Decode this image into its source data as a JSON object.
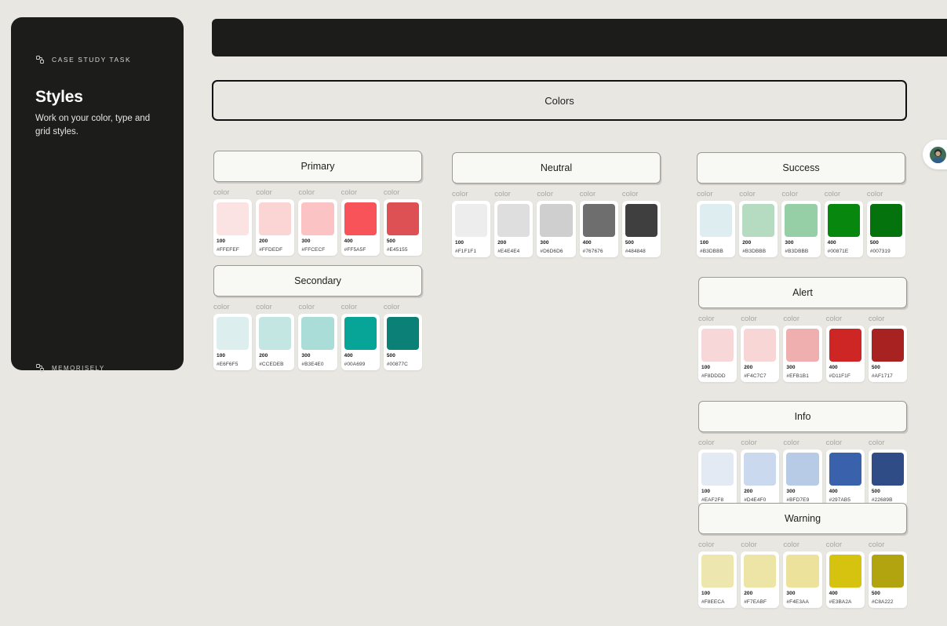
{
  "sidebar": {
    "tag_label": "Case study task",
    "tag_icon": "memorisely-logo-icon",
    "title": "Styles",
    "description": "Work on your color, type and grid styles.",
    "footer_label": "Memorisely",
    "footer_icon": "memorisely-logo-icon",
    "background_color": "#1C1C1B"
  },
  "topbar": {
    "background_color": "#1C1C1B"
  },
  "avatars": {
    "count": 2,
    "items": [
      {
        "name": "collaborator-avatar-1"
      },
      {
        "name": "collaborator-avatar-2"
      }
    ]
  },
  "canvas": {
    "background_color": "#E8E7E2",
    "selected_frame": {
      "title": "Colors",
      "border_color": "#111111"
    }
  },
  "color_groups": [
    {
      "name": "Primary",
      "swatch_caption": "color",
      "swatches": [
        {
          "step": "100",
          "hex": "#FFEFEF",
          "fill": "#FCE3E3"
        },
        {
          "step": "200",
          "hex": "#FFDEDF",
          "fill": "#FBD4D4"
        },
        {
          "step": "300",
          "hex": "#FFCECF",
          "fill": "#FBC3C3"
        },
        {
          "step": "400",
          "hex": "#FF5A5F",
          "fill": "#F75358"
        },
        {
          "step": "500",
          "hex": "#E45155",
          "fill": "#DD5054"
        }
      ]
    },
    {
      "name": "Secondary",
      "swatch_caption": "color",
      "swatches": [
        {
          "step": "100",
          "hex": "#E6F6F5",
          "fill": "#DCEFEE"
        },
        {
          "step": "200",
          "hex": "#CCEDEB",
          "fill": "#C4E6E3"
        },
        {
          "step": "300",
          "hex": "#B3E4E0",
          "fill": "#ABDDD8"
        },
        {
          "step": "400",
          "hex": "#00A699",
          "fill": "#07A598"
        },
        {
          "step": "500",
          "hex": "#00877C",
          "fill": "#0A8076"
        }
      ]
    },
    {
      "name": "Neutral",
      "swatch_caption": "color",
      "swatches": [
        {
          "step": "100",
          "hex": "#F1F1F1",
          "fill": "#EDEDED"
        },
        {
          "step": "200",
          "hex": "#E4E4E4",
          "fill": "#DEDEDE"
        },
        {
          "step": "300",
          "hex": "#D6D6D6",
          "fill": "#CFCFCF"
        },
        {
          "step": "400",
          "hex": "#767676",
          "fill": "#6E6E6E"
        },
        {
          "step": "500",
          "hex": "#484848",
          "fill": "#3F3F3F"
        }
      ]
    },
    {
      "name": "Success",
      "swatch_caption": "color",
      "swatches": [
        {
          "step": "100",
          "hex": "#B3DBBB",
          "fill": "#DEEEF0"
        },
        {
          "step": "200",
          "hex": "#B3DBBB",
          "fill": "#B5DCC0"
        },
        {
          "step": "300",
          "hex": "#B3DBBB",
          "fill": "#96CFA6"
        },
        {
          "step": "400",
          "hex": "#00871E",
          "fill": "#08870F"
        },
        {
          "step": "500",
          "hex": "#007319",
          "fill": "#04730D"
        }
      ]
    },
    {
      "name": "Alert",
      "swatch_caption": "color",
      "swatches": [
        {
          "step": "100",
          "hex": "#F8DDDD",
          "fill": "#F7D7D7"
        },
        {
          "step": "200",
          "hex": "#F4C7C7",
          "fill": "#F8D6D6"
        },
        {
          "step": "300",
          "hex": "#EFB1B1",
          "fill": "#EFAFAF"
        },
        {
          "step": "400",
          "hex": "#D11F1F",
          "fill": "#CE2525"
        },
        {
          "step": "500",
          "hex": "#AF1717",
          "fill": "#A92222"
        }
      ]
    },
    {
      "name": "Info",
      "swatch_caption": "color",
      "swatches": [
        {
          "step": "100",
          "hex": "#EAF2F8",
          "fill": "#E4EAF4"
        },
        {
          "step": "200",
          "hex": "#D4E4F0",
          "fill": "#CBD9EE"
        },
        {
          "step": "300",
          "hex": "#BFD7E9",
          "fill": "#B7CBE6"
        },
        {
          "step": "400",
          "hex": "#297AB5",
          "fill": "#3A62AC"
        },
        {
          "step": "500",
          "hex": "#22689B",
          "fill": "#2F4C86"
        }
      ]
    },
    {
      "name": "Warning",
      "swatch_caption": "color",
      "swatches": [
        {
          "step": "100",
          "hex": "#F8EECA",
          "fill": "#EDE7AF"
        },
        {
          "step": "200",
          "hex": "#F7EABF",
          "fill": "#EDE5A6"
        },
        {
          "step": "300",
          "hex": "#F4E3AA",
          "fill": "#ECE29B"
        },
        {
          "step": "400",
          "hex": "#E3BA2A",
          "fill": "#D6C310"
        },
        {
          "step": "500",
          "hex": "#C8A222",
          "fill": "#B2A40F"
        }
      ]
    }
  ]
}
